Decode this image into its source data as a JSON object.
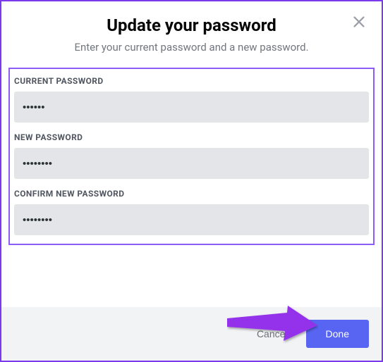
{
  "modal": {
    "title": "Update your password",
    "subtitle": "Enter your current password and a new password."
  },
  "fields": {
    "current": {
      "label": "CURRENT PASSWORD",
      "value": "••••••"
    },
    "new": {
      "label": "NEW PASSWORD",
      "value": "••••••••"
    },
    "confirm": {
      "label": "CONFIRM NEW PASSWORD",
      "value": "••••••••"
    }
  },
  "footer": {
    "cancel": "Cancel",
    "done": "Done"
  },
  "colors": {
    "accent": "#5865f2",
    "highlight_border": "#8b5cf6",
    "annotation_arrow": "#9333ea"
  }
}
